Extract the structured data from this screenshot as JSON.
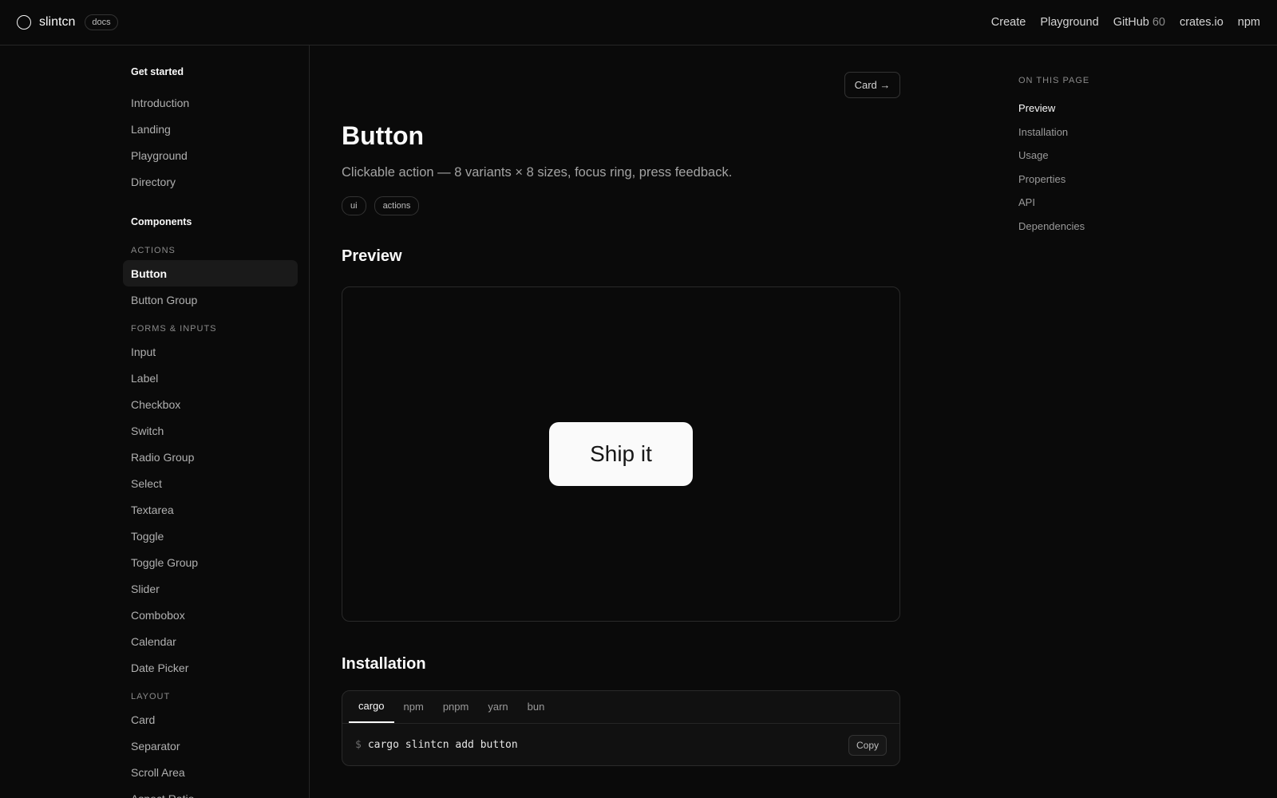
{
  "header": {
    "brand": "slintcn",
    "badge": "docs",
    "nav": {
      "create": "Create",
      "playground": "Playground",
      "github": "GitHub",
      "github_count": "60",
      "crates": "crates.io",
      "npm": "npm"
    }
  },
  "sidebar": {
    "get_started": {
      "heading": "Get started",
      "items": [
        "Introduction",
        "Landing",
        "Playground",
        "Directory"
      ]
    },
    "components": {
      "heading": "Components",
      "actions_label": "ACTIONS",
      "actions": [
        "Button",
        "Button Group"
      ],
      "forms_label": "FORMS & INPUTS",
      "forms": [
        "Input",
        "Label",
        "Checkbox",
        "Switch",
        "Radio Group",
        "Select",
        "Textarea",
        "Toggle",
        "Toggle Group",
        "Slider",
        "Combobox",
        "Calendar",
        "Date Picker"
      ],
      "layout_label": "LAYOUT",
      "layout": [
        "Card",
        "Separator",
        "Scroll Area",
        "Aspect Ratio"
      ]
    },
    "active": "Button"
  },
  "main": {
    "next_link": "Card →",
    "title": "Button",
    "description": "Clickable action — 8 variants × 8 sizes, focus ring, press feedback.",
    "tags": [
      "ui",
      "actions"
    ],
    "preview_heading": "Preview",
    "preview_button": "Ship it",
    "installation_heading": "Installation",
    "package_managers": [
      "cargo",
      "npm",
      "pnpm",
      "yarn",
      "bun"
    ],
    "active_pm": "cargo",
    "prompt": "$",
    "command": "cargo slintcn add button",
    "copy_label": "Copy"
  },
  "toc": {
    "title": "ON THIS PAGE",
    "items": [
      "Preview",
      "Installation",
      "Usage",
      "Properties",
      "API",
      "Dependencies"
    ],
    "active": "Preview"
  }
}
